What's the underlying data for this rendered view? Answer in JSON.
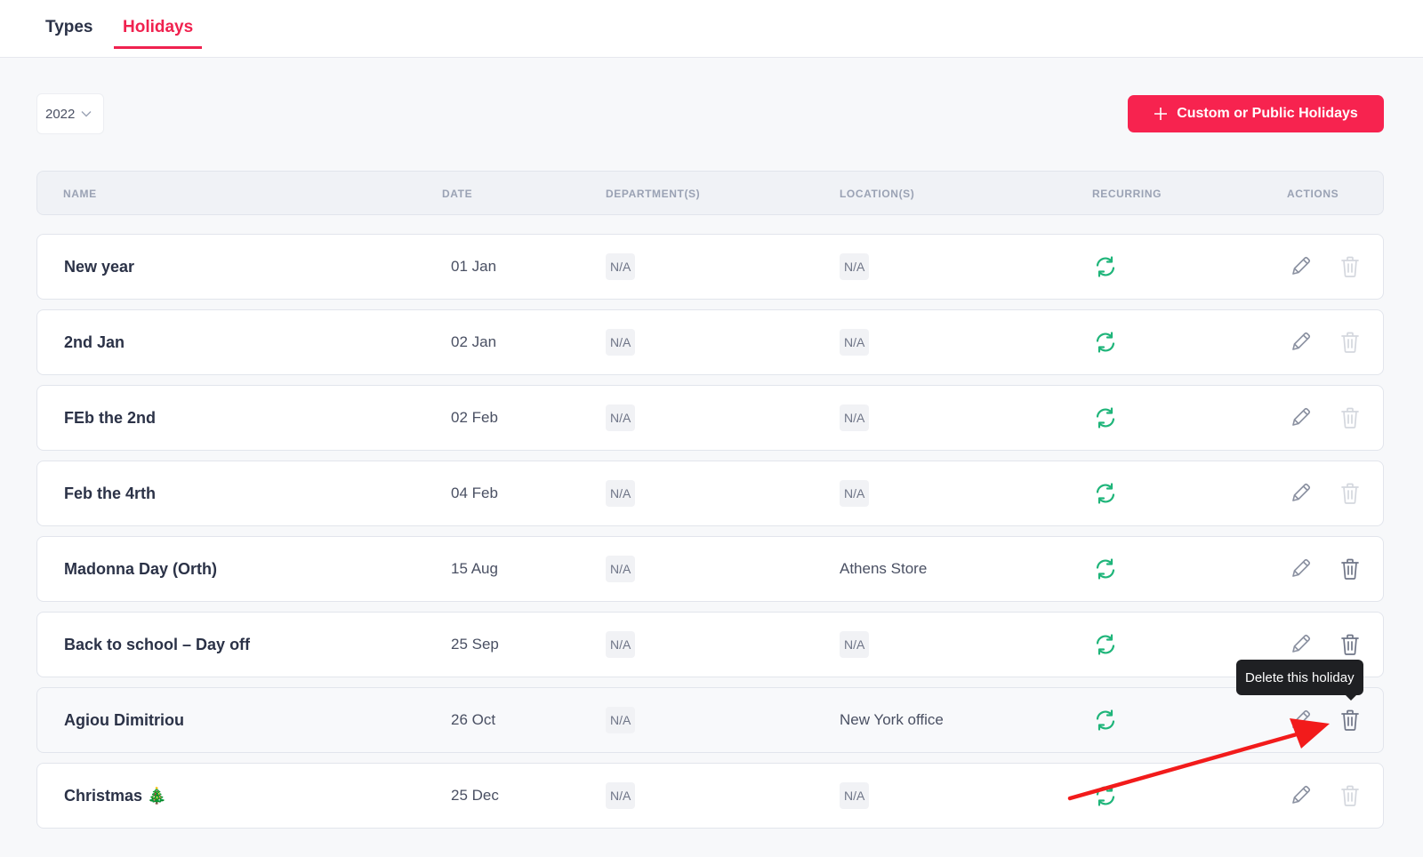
{
  "tabs": [
    {
      "label": "Types",
      "active": false
    },
    {
      "label": "Holidays",
      "active": true
    }
  ],
  "year_filter": {
    "value": "2022"
  },
  "add_button": {
    "label": "Custom or Public Holidays",
    "icon": "plus-icon"
  },
  "table": {
    "columns": [
      "NAME",
      "DATE",
      "DEPARTMENT(S)",
      "LOCATION(S)",
      "RECURRING",
      "ACTIONS"
    ],
    "rows": [
      {
        "name": "New year",
        "date": "01 Jan",
        "departments": "N/A",
        "locations": "N/A",
        "recurring": true,
        "delete_enabled": false
      },
      {
        "name": "2nd Jan",
        "date": "02 Jan",
        "departments": "N/A",
        "locations": "N/A",
        "recurring": true,
        "delete_enabled": false
      },
      {
        "name": "FEb the 2nd",
        "date": "02 Feb",
        "departments": "N/A",
        "locations": "N/A",
        "recurring": true,
        "delete_enabled": false
      },
      {
        "name": "Feb the 4rth",
        "date": "04 Feb",
        "departments": "N/A",
        "locations": "N/A",
        "recurring": true,
        "delete_enabled": false
      },
      {
        "name": "Madonna Day (Orth)",
        "date": "15 Aug",
        "departments": "N/A",
        "locations": "Athens Store",
        "recurring": true,
        "delete_enabled": true
      },
      {
        "name": "Back to school – Day off",
        "date": "25 Sep",
        "departments": "N/A",
        "locations": "N/A",
        "recurring": true,
        "delete_enabled": true
      },
      {
        "name": "Agiou Dimitriou",
        "date": "26 Oct",
        "departments": "N/A",
        "locations": "New York office",
        "recurring": true,
        "delete_enabled": true
      },
      {
        "name": "Christmas 🎄",
        "date": "25 Dec",
        "departments": "N/A",
        "locations": "N/A",
        "recurring": true,
        "delete_enabled": false
      }
    ]
  },
  "tooltip": {
    "text": "Delete this holiday"
  },
  "colors": {
    "accent": "#f7234f",
    "recurring_icon": "#1fb57a",
    "edit_icon": "#8b91a1",
    "delete_icon_enabled": "#6f7587",
    "delete_icon_disabled": "#d4d7de",
    "annotation_arrow": "#f21b1b"
  }
}
